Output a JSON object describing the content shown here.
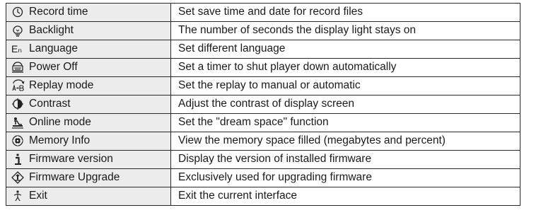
{
  "rows": [
    {
      "name": "Record time",
      "icon": "clock-icon",
      "description": "Set save time and date for record files"
    },
    {
      "name": "Backlight",
      "icon": "bulb-icon",
      "description": "The number of seconds the display light stays on"
    },
    {
      "name": "Language",
      "icon": "language-icon",
      "description": "Set different language"
    },
    {
      "name": "Power Off",
      "icon": "power-timer-icon",
      "description": "Set a timer to shut player down automatically"
    },
    {
      "name": "Replay mode",
      "icon": "replay-ab-icon",
      "description": "Set the replay to manual or automatic"
    },
    {
      "name": "Contrast",
      "icon": "contrast-icon",
      "description": "Adjust the contrast of display screen"
    },
    {
      "name": "Online mode",
      "icon": "online-icon",
      "description": "Set the \"dream space\" function"
    },
    {
      "name": "Memory Info",
      "icon": "memory-icon",
      "description": "View the memory space filled (megabytes and percent)"
    },
    {
      "name": "Firmware version",
      "icon": "info-icon",
      "description": "Display the version of installed firmware"
    },
    {
      "name": "Firmware Upgrade",
      "icon": "upgrade-icon",
      "description": "Exclusively used for upgrading firmware"
    },
    {
      "name": "Exit",
      "icon": "exit-icon",
      "description": "Exit the current interface"
    }
  ],
  "icon_glyph": {
    "language-icon": "Eₙ"
  }
}
